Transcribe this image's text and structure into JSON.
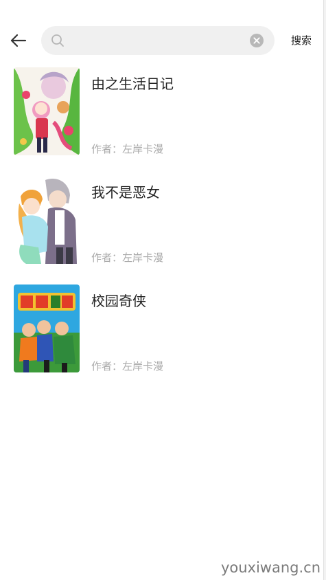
{
  "search": {
    "placeholder": "",
    "value": "",
    "button_label": "搜索"
  },
  "results": [
    {
      "title": "由之生活日记",
      "author_label": "作者：",
      "author": "左岸卡漫"
    },
    {
      "title": "我不是恶女",
      "author_label": "作者：",
      "author": "左岸卡漫"
    },
    {
      "title": "校园奇侠",
      "author_label": "作者：",
      "author": "左岸卡漫"
    }
  ],
  "watermark": "youxiwang.cn",
  "colors": {
    "search_bg": "#f0f0f0",
    "author_text": "#aaaaaa",
    "title_text": "#222222"
  }
}
